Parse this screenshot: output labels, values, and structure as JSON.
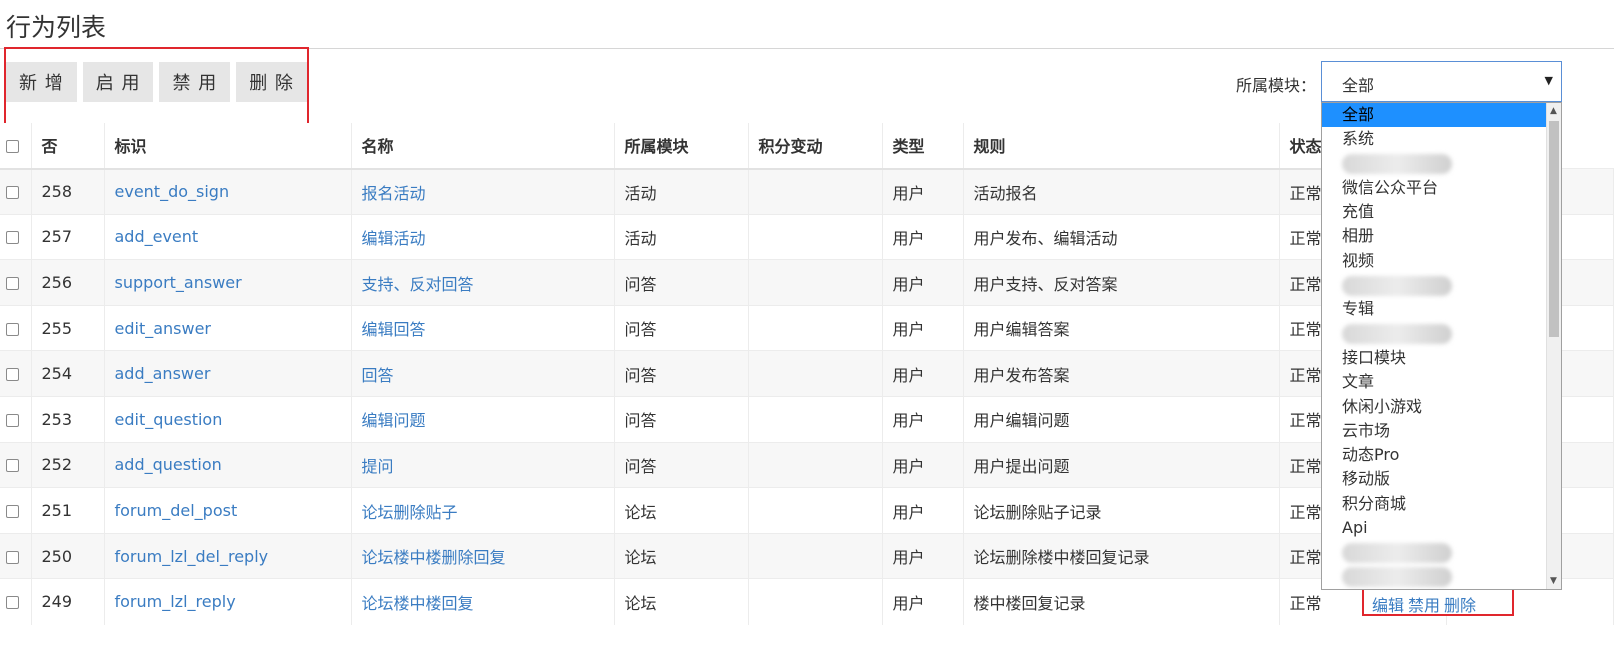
{
  "page": {
    "title": "行为列表"
  },
  "toolbar": {
    "add_label": "新 增",
    "enable_label": "启 用",
    "disable_label": "禁 用",
    "delete_label": "删 除"
  },
  "filter": {
    "label": "所属模块：",
    "selected": "全部"
  },
  "table": {
    "headers": [
      "否",
      "标识",
      "名称",
      "所属模块",
      "积分变动",
      "类型",
      "规则",
      "状态"
    ],
    "rows": [
      {
        "id": "258",
        "ident": "event_do_sign",
        "name": "报名活动",
        "module": "活动",
        "score": "",
        "type": "用户",
        "rule": "活动报名",
        "status": "正常"
      },
      {
        "id": "257",
        "ident": "add_event",
        "name": "编辑活动",
        "module": "活动",
        "score": "",
        "type": "用户",
        "rule": "用户发布、编辑活动",
        "status": "正常"
      },
      {
        "id": "256",
        "ident": "support_answer",
        "name": "支持、反对回答",
        "module": "问答",
        "score": "",
        "type": "用户",
        "rule": "用户支持、反对答案",
        "status": "正常"
      },
      {
        "id": "255",
        "ident": "edit_answer",
        "name": "编辑回答",
        "module": "问答",
        "score": "",
        "type": "用户",
        "rule": "用户编辑答案",
        "status": "正常"
      },
      {
        "id": "254",
        "ident": "add_answer",
        "name": "回答",
        "module": "问答",
        "score": "",
        "type": "用户",
        "rule": "用户发布答案",
        "status": "正常"
      },
      {
        "id": "253",
        "ident": "edit_question",
        "name": "编辑问题",
        "module": "问答",
        "score": "",
        "type": "用户",
        "rule": "用户编辑问题",
        "status": "正常"
      },
      {
        "id": "252",
        "ident": "add_question",
        "name": "提问",
        "module": "问答",
        "score": "",
        "type": "用户",
        "rule": "用户提出问题",
        "status": "正常"
      },
      {
        "id": "251",
        "ident": "forum_del_post",
        "name": "论坛删除贴子",
        "module": "论坛",
        "score": "",
        "type": "用户",
        "rule": "论坛删除贴子记录",
        "status": "正常"
      },
      {
        "id": "250",
        "ident": "forum_lzl_del_reply",
        "name": "论坛楼中楼删除回复",
        "module": "论坛",
        "score": "",
        "type": "用户",
        "rule": "论坛删除楼中楼回复记录",
        "status": "正常"
      },
      {
        "id": "249",
        "ident": "forum_lzl_reply",
        "name": "论坛楼中楼回复",
        "module": "论坛",
        "score": "",
        "type": "用户",
        "rule": "楼中楼回复记录",
        "status": "正常"
      }
    ]
  },
  "row_actions": {
    "edit": "编辑",
    "disable": "禁用",
    "delete": "删除"
  },
  "dropdown": {
    "options": [
      {
        "label": "全部",
        "selected": true
      },
      {
        "label": "系统"
      },
      {
        "label": "",
        "blurred": true
      },
      {
        "label": "微信公众平台"
      },
      {
        "label": "充值"
      },
      {
        "label": "相册"
      },
      {
        "label": "视频"
      },
      {
        "label": "",
        "blurred": true
      },
      {
        "label": "专辑"
      },
      {
        "label": "",
        "blurred": true
      },
      {
        "label": "接口模块"
      },
      {
        "label": "文章"
      },
      {
        "label": "休闲小游戏"
      },
      {
        "label": "云市场"
      },
      {
        "label": "动态Pro"
      },
      {
        "label": "移动版"
      },
      {
        "label": "积分商城"
      },
      {
        "label": "Api"
      },
      {
        "label": "",
        "blurred": true
      },
      {
        "label": "",
        "blurred": true
      }
    ]
  }
}
